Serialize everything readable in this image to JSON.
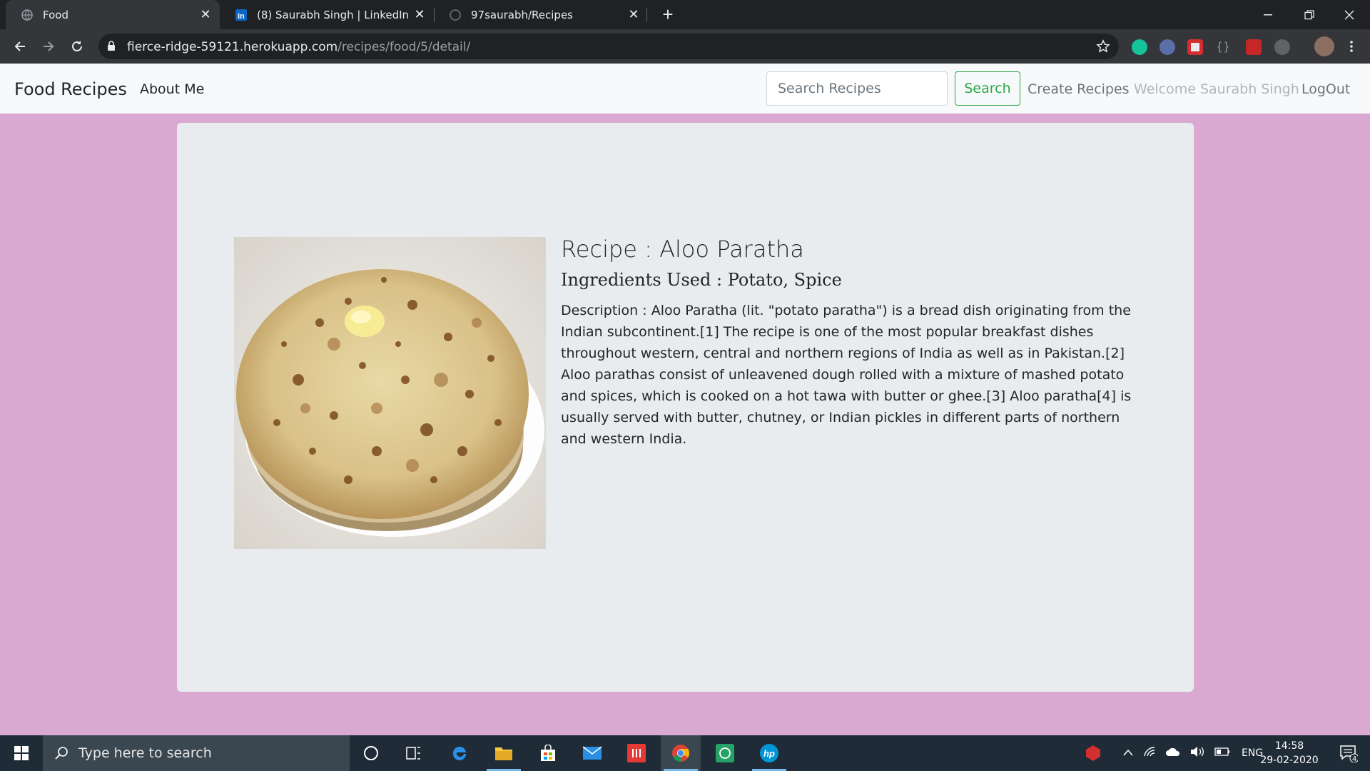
{
  "browser": {
    "tabs": [
      {
        "title": "Food",
        "icon": "globe-icon",
        "active": true
      },
      {
        "title": "(8) Saurabh Singh | LinkedIn",
        "icon": "linkedin-icon",
        "active": false
      },
      {
        "title": "97saurabh/Recipes",
        "icon": "github-icon",
        "active": false
      }
    ],
    "url_host": "fierce-ridge-59121.herokuapp.com",
    "url_path": "/recipes/food/5/detail/"
  },
  "navbar": {
    "brand": "Food Recipes",
    "about": "About Me",
    "search_placeholder": "Search Recipes",
    "search_button": "Search",
    "create": "Create Recipes",
    "welcome": "Welcome Saurabh Singh",
    "logout": "LogOut"
  },
  "recipe": {
    "title": "Recipe : Aloo Paratha",
    "ingredients": "Ingredients Used : Potato, Spice",
    "description": "Description : Aloo Paratha (lit. \"potato paratha\") is a bread dish originating from the Indian subcontinent.[1] The recipe is one of the most popular breakfast dishes throughout western, central and northern regions of India as well as in Pakistan.[2] Aloo parathas consist of unleavened dough rolled with a mixture of mashed potato and spices, which is cooked on a hot tawa with butter or ghee.[3] Aloo paratha[4] is usually served with butter, chutney, or Indian pickles in different parts of northern and western India."
  },
  "taskbar": {
    "search_placeholder": "Type here to search",
    "language": "ENG",
    "time": "14:58",
    "date": "29-02-2020",
    "notification_count": "4"
  },
  "colors": {
    "page_bg": "#d9a9d1",
    "card_bg": "#e9ecef",
    "search_green": "#28a745"
  }
}
